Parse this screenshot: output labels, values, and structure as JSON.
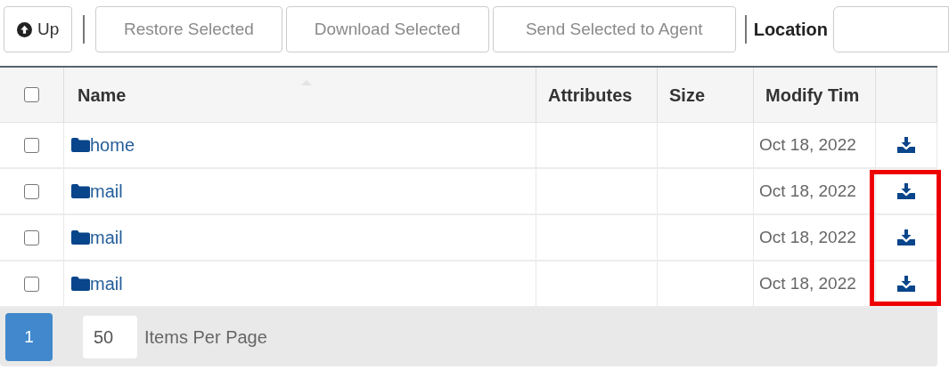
{
  "toolbar": {
    "up_button": "Up",
    "actions": [
      {
        "label": "Restore Selected",
        "disabled": true
      },
      {
        "label": "Download Selected",
        "disabled": true
      },
      {
        "label": "Send Selected to Agent",
        "disabled": true
      }
    ],
    "location_label": "Location"
  },
  "table": {
    "select_all": {
      "checked": false
    },
    "columns": [
      "Name",
      "Attributes",
      "Size",
      "Modify Tim"
    ],
    "rows": [
      {
        "checked": false,
        "name": "home",
        "modify_time": "Oct 18, 2022"
      },
      {
        "checked": false,
        "name": "mail",
        "modify_time": "Oct 18, 2022"
      },
      {
        "checked": false,
        "name": "mail",
        "modify_time": "Oct 18, 2022"
      },
      {
        "checked": false,
        "name": "mail",
        "modify_time": "Oct 18, 2022"
      }
    ]
  },
  "pagination": {
    "pages": [
      {
        "label": "1",
        "selected": true
      }
    ],
    "page_size": "50",
    "page_size_label": "Items Per Page"
  }
}
